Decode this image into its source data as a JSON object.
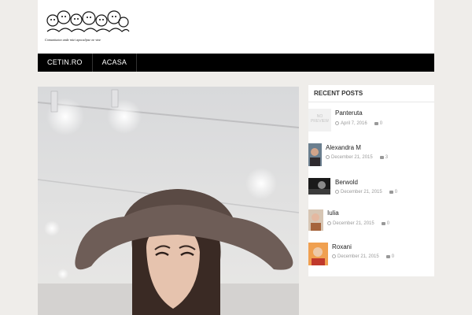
{
  "site": {
    "logo_caption": "Comunitatea unde mici apocalipse ne vine"
  },
  "nav": {
    "items": [
      "CETIN.RO",
      "ACASA"
    ]
  },
  "sidebar": {
    "heading": "RECENT POSTS",
    "no_preview": "NO PREVIEW",
    "posts": [
      {
        "title": "Panteruta",
        "date": "April 7, 2016",
        "comments": "0"
      },
      {
        "title": "Alexandra M",
        "date": "December 21, 2015",
        "comments": "3"
      },
      {
        "title": "Berwold",
        "date": "December 21, 2015",
        "comments": "0"
      },
      {
        "title": "Iulia",
        "date": "December 21, 2015",
        "comments": "0"
      },
      {
        "title": "Roxani",
        "date": "December 21, 2015",
        "comments": "0"
      }
    ]
  },
  "colors": {
    "nav_bg": "#000000",
    "page_bg": "#efedea",
    "hat": "#6e5d57"
  }
}
